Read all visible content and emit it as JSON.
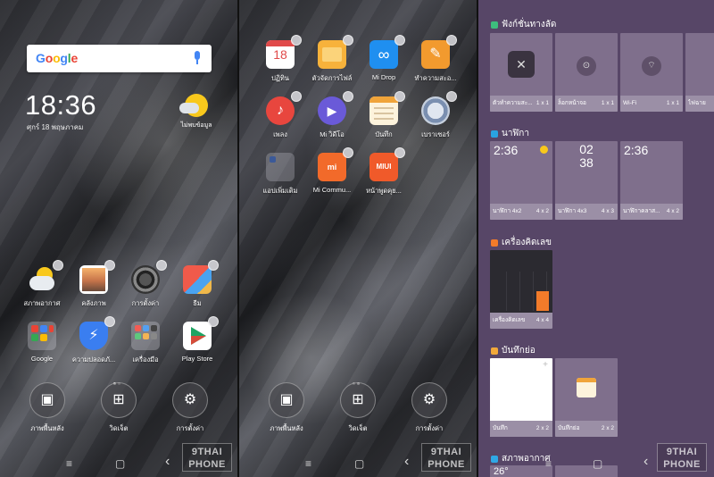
{
  "home": {
    "search_logo": "Google",
    "time": "18:36",
    "date": "ศุกร์ 18 พฤษภาคม",
    "weather_label": "ไม่พบข้อมูล",
    "apps_row1": [
      "สภาพอากาศ",
      "คลังภาพ",
      "การตั้งค่า",
      "ธีม"
    ],
    "apps_row2": [
      "Google",
      "ความปลอดภั...",
      "เครื่องมือ",
      "Play Store"
    ],
    "dock": [
      "ภาพพื้นหลัง",
      "วิดเจ็ต",
      "การตั้งค่า"
    ]
  },
  "page2": {
    "apps_row1": [
      "ปฏิทิน",
      "ตัวจัดการไฟล์",
      "Mi Drop",
      "ทำความสะอ..."
    ],
    "apps_row2": [
      "เพลง",
      "Mi วิดีโอ",
      "บันทึก",
      "เบราเซอร์"
    ],
    "apps_row3": [
      "แอปเพิ่มเติม",
      "Mi Commu...",
      "หน้าพูดคุย..."
    ],
    "calendar_day": "18",
    "dock": [
      "ภาพพื้นหลัง",
      "วิดเจ็ต",
      "การตั้งค่า"
    ]
  },
  "widgets": {
    "sections": [
      {
        "title": "ฟังก์ชั่นทางลัด",
        "color": "#3dbd7d"
      },
      {
        "title": "นาฬิกา",
        "color": "#29a3e0"
      },
      {
        "title": "เครื่องคิดเลข",
        "color": "#f27b2a"
      },
      {
        "title": "บันทึกย่อ",
        "color": "#f2a93a"
      },
      {
        "title": "สภาพอากาศ",
        "color": "#2fa8e6"
      }
    ],
    "shortcuts": [
      {
        "name": "ตัวทำความสะ...",
        "size": "1 x 1"
      },
      {
        "name": "ล็อกหน้าจอ",
        "size": "1 x 1"
      },
      {
        "name": "Wi-Fi",
        "size": "1 x 1"
      },
      {
        "name": "ไฟฉาย",
        "size": ""
      }
    ],
    "clocks": [
      {
        "name": "นาฬิกา 4x2",
        "size": "4 x 2",
        "time": "2:36"
      },
      {
        "name": "นาฬิกา 4x3",
        "size": "4 x 3",
        "time_h": "02",
        "time_m": "38"
      },
      {
        "name": "นาฬิกาคลาส...",
        "size": "4 x 2",
        "time": "2:36"
      }
    ],
    "calculator": {
      "name": "เครื่องคิดเลข",
      "size": "4 x 4"
    },
    "notes": [
      {
        "name": "บันทึก",
        "size": "2 x 2"
      },
      {
        "name": "บันทึกย่อ",
        "size": "2 x 2"
      }
    ],
    "weather_temp": "26°"
  },
  "watermark": {
    "line1": "9THAI",
    "line2": "PHONE"
  },
  "nav": {
    "menu": "≡",
    "home": "▢",
    "back": "‹"
  }
}
